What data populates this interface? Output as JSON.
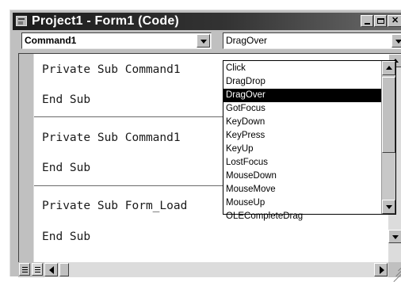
{
  "window": {
    "title": "Project1 - Form1 (Code)",
    "caption_buttons": [
      "minimize-icon",
      "maximize-icon",
      "close-icon"
    ]
  },
  "object_combo": {
    "value": "Command1",
    "icon": "chevron-down-icon"
  },
  "procedure_combo": {
    "value": "DragOver",
    "icon": "chevron-down-icon"
  },
  "code": {
    "lines": [
      "Private Sub Command1",
      "End Sub",
      "Private Sub Command1",
      "End Sub",
      "Private Sub Form_Load",
      "End Sub"
    ]
  },
  "dropdown": {
    "items": [
      "Click",
      "DragDrop",
      "DragOver",
      "GotFocus",
      "KeyDown",
      "KeyPress",
      "KeyUp",
      "LostFocus",
      "MouseDown",
      "MouseMove",
      "MouseUp",
      "OLECompleteDrag"
    ],
    "selected": "DragOver"
  },
  "colors": {
    "selection_bg": "#000000",
    "selection_fg": "#ffffff",
    "face": "#c0c0c0"
  }
}
